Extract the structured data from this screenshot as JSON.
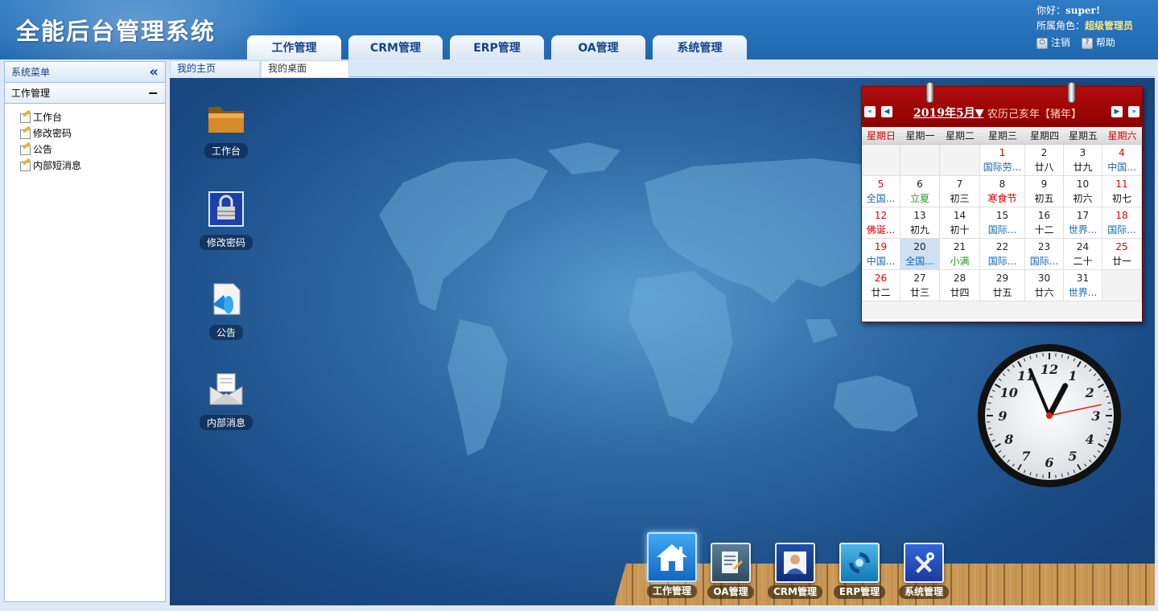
{
  "header": {
    "app_title": "全能后台管理系统",
    "tabs": [
      {
        "label": "工作管理"
      },
      {
        "label": "CRM管理"
      },
      {
        "label": "ERP管理"
      },
      {
        "label": "OA管理"
      },
      {
        "label": "系统管理"
      }
    ],
    "user": {
      "greeting_label": "你好：",
      "username": "super!",
      "role_label": "所属角色：",
      "role": "超级管理员",
      "logout": "注销",
      "help": "帮助"
    }
  },
  "sidebar": {
    "title": "系统菜单",
    "group": "工作管理",
    "items": [
      {
        "label": "工作台"
      },
      {
        "label": "修改密码"
      },
      {
        "label": "公告"
      },
      {
        "label": "内部短消息"
      }
    ]
  },
  "content_tabs": [
    {
      "label": "我的主页"
    },
    {
      "label": "我的桌面"
    }
  ],
  "desktop": {
    "icons": [
      {
        "label": "工作台",
        "icon": "folder-icon"
      },
      {
        "label": "修改密码",
        "icon": "lock-icon"
      },
      {
        "label": "公告",
        "icon": "megaphone-icon"
      },
      {
        "label": "内部消息",
        "icon": "mail-icon"
      }
    ]
  },
  "calendar": {
    "month_label": "2019年5月▼",
    "lunar_label": "农历己亥年【猪年】",
    "weekdays": [
      "星期日",
      "星期一",
      "星期二",
      "星期三",
      "星期四",
      "星期五",
      "星期六"
    ],
    "rows": [
      [
        null,
        null,
        null,
        {
          "d": "1",
          "l": "国际劳...",
          "lc": "blue",
          "dc": "red"
        },
        {
          "d": "2",
          "l": "廿八"
        },
        {
          "d": "3",
          "l": "廿九"
        },
        {
          "d": "4",
          "l": "中国...",
          "lc": "blue",
          "dc": "red"
        }
      ],
      [
        {
          "d": "5",
          "l": "全国...",
          "lc": "blue",
          "dc": "red"
        },
        {
          "d": "6",
          "l": "立夏",
          "lc": "green"
        },
        {
          "d": "7",
          "l": "初三"
        },
        {
          "d": "8",
          "l": "寒食节",
          "lc": "red"
        },
        {
          "d": "9",
          "l": "初五"
        },
        {
          "d": "10",
          "l": "初六"
        },
        {
          "d": "11",
          "l": "初七",
          "dc": "red"
        }
      ],
      [
        {
          "d": "12",
          "l": "佛诞...",
          "lc": "red",
          "dc": "red"
        },
        {
          "d": "13",
          "l": "初九"
        },
        {
          "d": "14",
          "l": "初十"
        },
        {
          "d": "15",
          "l": "国际...",
          "lc": "blue"
        },
        {
          "d": "16",
          "l": "十二"
        },
        {
          "d": "17",
          "l": "世界...",
          "lc": "blue"
        },
        {
          "d": "18",
          "l": "国际...",
          "lc": "blue",
          "dc": "red"
        }
      ],
      [
        {
          "d": "19",
          "l": "中国...",
          "lc": "blue",
          "dc": "red"
        },
        {
          "d": "20",
          "l": "全国...",
          "lc": "blue",
          "today": true
        },
        {
          "d": "21",
          "l": "小满",
          "lc": "green"
        },
        {
          "d": "22",
          "l": "国际...",
          "lc": "blue"
        },
        {
          "d": "23",
          "l": "国际...",
          "lc": "blue"
        },
        {
          "d": "24",
          "l": "二十"
        },
        {
          "d": "25",
          "l": "廿一",
          "dc": "red"
        }
      ],
      [
        {
          "d": "26",
          "l": "廿二",
          "dc": "red"
        },
        {
          "d": "27",
          "l": "廿三"
        },
        {
          "d": "28",
          "l": "廿四"
        },
        {
          "d": "29",
          "l": "廿五"
        },
        {
          "d": "30",
          "l": "廿六"
        },
        {
          "d": "31",
          "l": "世界...",
          "lc": "blue"
        },
        null
      ]
    ]
  },
  "clock": {
    "numerals": [
      "12",
      "1",
      "2",
      "3",
      "4",
      "5",
      "6",
      "7",
      "8",
      "9",
      "10",
      "11"
    ],
    "time": {
      "hour": 12,
      "minute": 56,
      "second": 13
    }
  },
  "dock": {
    "items": [
      {
        "label": "工作管理",
        "icon": "home-icon"
      },
      {
        "label": "OA管理",
        "icon": "document-icon"
      },
      {
        "label": "CRM管理",
        "icon": "user-icon"
      },
      {
        "label": "ERP管理",
        "icon": "refresh-icon"
      },
      {
        "label": "系统管理",
        "icon": "tools-icon"
      }
    ]
  },
  "colors": {
    "header_blue": "#1f68b0",
    "calendar_red": "#8d0000",
    "desktop_blue": "#1b4c86",
    "role_yellow": "#ffe37a"
  }
}
